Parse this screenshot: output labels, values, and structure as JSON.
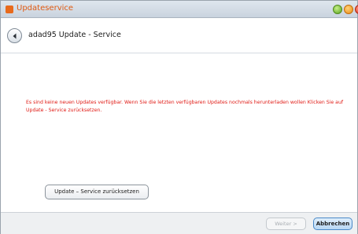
{
  "window": {
    "title": "Updateservice"
  },
  "nav": {
    "title": "adad95 Update - Service"
  },
  "content": {
    "message": "Es sind keine neuen Updates verfügbar. Wenn Sie die letzten verfügbaren Updates nochmals herunterladen wollen Klicken Sie auf Update - Service zurücksetzen.",
    "reset_button": "Update – Service zurücksetzen"
  },
  "footer": {
    "next_button": "Weiter >",
    "cancel_button": "Abbrechen"
  },
  "icons": {
    "app": "app-icon",
    "back": "back-arrow-icon",
    "minimize": "minimize-icon",
    "maximize": "maximize-icon",
    "close": "close-icon"
  },
  "colors": {
    "message_text": "#e01a14",
    "title_text": "#e05a12",
    "close_button": "#d8311b",
    "maximize_button": "#e98a12",
    "minimize_button": "#5aa21e"
  }
}
